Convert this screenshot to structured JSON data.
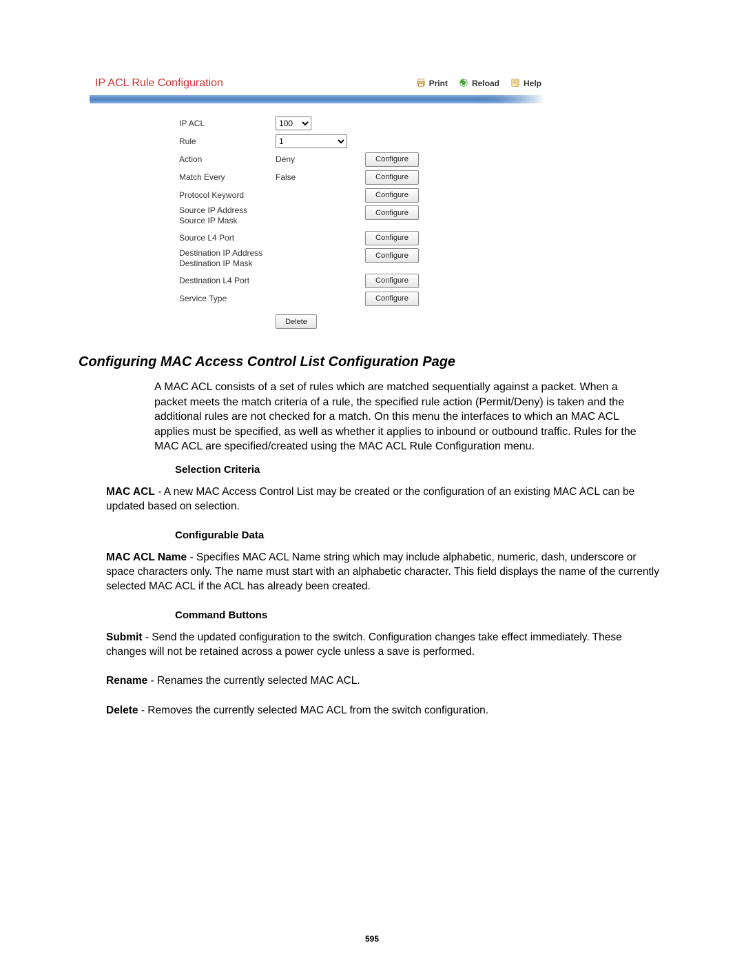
{
  "panel": {
    "title": "IP ACL Rule Configuration",
    "actions": {
      "print": "Print",
      "reload": "Reload",
      "help": "Help"
    },
    "ip_acl_label": "IP ACL",
    "ip_acl_value": "100",
    "rule_label": "Rule",
    "rule_value": "1",
    "rows": [
      {
        "label": "Action",
        "value": "Deny",
        "button": "Configure"
      },
      {
        "label": "Match Every",
        "value": "False",
        "button": "Configure"
      },
      {
        "label": "Protocol Keyword",
        "value": "",
        "button": "Configure"
      },
      {
        "label": "Source IP Address\nSource IP Mask",
        "value": "",
        "button": "Configure",
        "tall": true
      },
      {
        "label": "Source L4 Port",
        "value": "",
        "button": "Configure"
      },
      {
        "label": "Destination IP Address\nDestination IP Mask",
        "value": "",
        "button": "Configure",
        "tall": true
      },
      {
        "label": "Destination L4 Port",
        "value": "",
        "button": "Configure"
      },
      {
        "label": "Service Type",
        "value": "",
        "button": "Configure"
      }
    ],
    "delete_button": "Delete"
  },
  "doc": {
    "heading": "Configuring MAC Access Control List Configuration Page",
    "intro": "A MAC ACL consists of a set of rules which are matched sequentially against a packet. When a packet meets the match criteria of a rule, the specified rule action (Permit/Deny) is taken and the additional rules are not checked for a match. On this menu the interfaces to which an MAC ACL applies must be specified, as well as whether it applies to inbound or outbound traffic. Rules for the MAC ACL are specified/created using the MAC ACL Rule Configuration menu.",
    "selection_criteria_title": "Selection Criteria",
    "mac_acl_bold": "MAC ACL",
    "mac_acl_body": " - A new MAC Access Control List may be created or the configuration of an existing MAC ACL can be updated based on selection.",
    "configurable_data_title": "Configurable Data",
    "mac_acl_name_bold": "MAC ACL Name",
    "mac_acl_name_body": " - Specifies MAC ACL Name string which may include alphabetic, numeric, dash, underscore or space characters only. The name must start with an alphabetic character. This field displays the name of the currently selected MAC ACL if the ACL has already been created.",
    "command_buttons_title": "Command Buttons",
    "submit_bold": "Submit",
    "submit_body": " - Send the updated configuration to the switch. Configuration changes take effect immediately. These changes will not be retained across a power cycle unless a save is performed.",
    "rename_bold": "Rename",
    "rename_body": " - Renames the currently selected MAC ACL.",
    "delete_bold": "Delete",
    "delete_body": " - Removes the currently selected MAC ACL from the switch configuration."
  },
  "page_number": "595"
}
